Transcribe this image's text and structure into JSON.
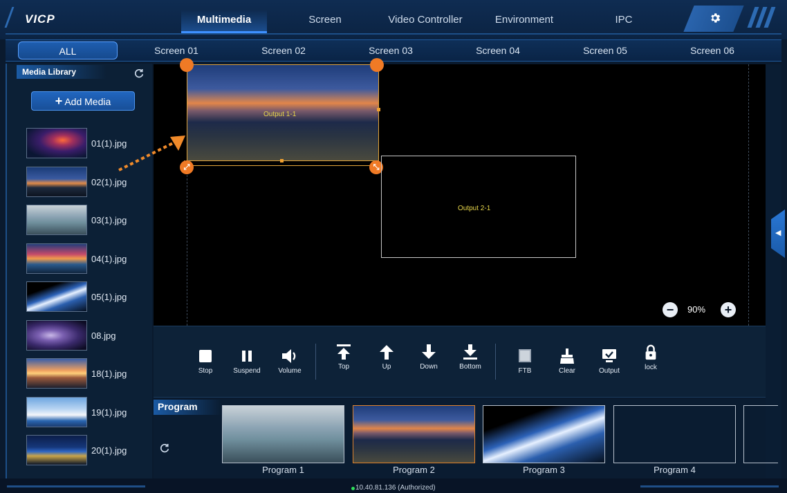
{
  "app": {
    "logo": "VICP"
  },
  "main_tabs": [
    "Multimedia",
    "Screen",
    "Video Controller",
    "Environment",
    "IPC"
  ],
  "screen_tabs": [
    "ALL",
    "Screen 01",
    "Screen 02",
    "Screen 03",
    "Screen 04",
    "Screen 05",
    "Screen 06"
  ],
  "library": {
    "title": "Media Library",
    "add_label": "Add Media",
    "items": [
      {
        "name": "01(1).jpg",
        "thumb": "img-galaxy"
      },
      {
        "name": "02(1).jpg",
        "thumb": "img-city"
      },
      {
        "name": "03(1).jpg",
        "thumb": "img-room"
      },
      {
        "name": "04(1).jpg",
        "thumb": "img-sunsetsea"
      },
      {
        "name": "05(1).jpg",
        "thumb": "img-earth"
      },
      {
        "name": "08.jpg",
        "thumb": "img-nebula"
      },
      {
        "name": "18(1).jpg",
        "thumb": "img-sunsetpier"
      },
      {
        "name": "19(1).jpg",
        "thumb": "img-santorini"
      },
      {
        "name": "20(1).jpg",
        "thumb": "img-skyline"
      }
    ]
  },
  "canvas": {
    "outputs": [
      "Output 1-1",
      "Output 2-1"
    ],
    "zoom": "90%"
  },
  "toolbar": {
    "stop": "Stop",
    "suspend": "Suspend",
    "volume": "Volume",
    "top": "Top",
    "up": "Up",
    "down": "Down",
    "bottom": "Bottom",
    "ftb": "FTB",
    "clear": "Clear",
    "output": "Output",
    "lock": "lock"
  },
  "program": {
    "title": "Program",
    "items": [
      "Program 1",
      "Program 2",
      "Program 3",
      "Program 4"
    ]
  },
  "status": {
    "text": "10.40.81.136 (Authorized)",
    "online_color": "#2ee05a"
  },
  "colors": {
    "accent": "#1e5eb0",
    "handle": "#f07a25",
    "output_label": "#e7d64b"
  }
}
